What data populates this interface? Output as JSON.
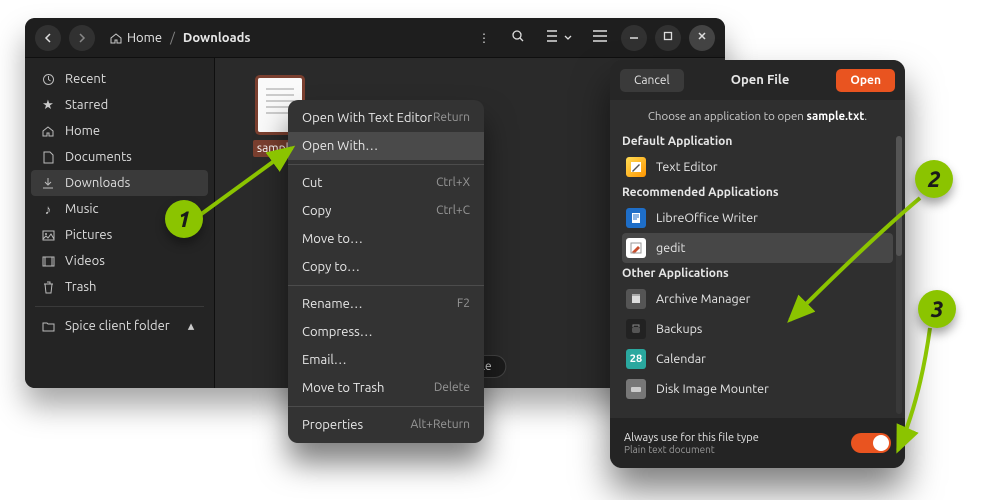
{
  "breadcrumb": {
    "home": "Home",
    "downloads": "Downloads"
  },
  "sidebar": {
    "items": [
      {
        "label": "Recent"
      },
      {
        "label": "Starred"
      },
      {
        "label": "Home"
      },
      {
        "label": "Documents"
      },
      {
        "label": "Downloads"
      },
      {
        "label": "Music"
      },
      {
        "label": "Pictures"
      },
      {
        "label": "Videos"
      },
      {
        "label": "Trash"
      }
    ],
    "spice": "Spice client folder"
  },
  "file": {
    "name": "sample.txt",
    "nameShort": "sample.t"
  },
  "statusbar": "\"sample",
  "ctx": [
    {
      "label": "Open With Text Editor",
      "accel": "Return"
    },
    {
      "label": "Open With…",
      "hl": true
    },
    null,
    {
      "label": "Cut",
      "accel": "Ctrl+X"
    },
    {
      "label": "Copy",
      "accel": "Ctrl+C"
    },
    {
      "label": "Move to…"
    },
    {
      "label": "Copy to…"
    },
    null,
    {
      "label": "Rename…",
      "accel": "F2"
    },
    {
      "label": "Compress…"
    },
    {
      "label": "Email…"
    },
    {
      "label": "Move to Trash",
      "accel": "Delete"
    },
    null,
    {
      "label": "Properties",
      "accel": "Alt+Return"
    }
  ],
  "dialog": {
    "cancel": "Cancel",
    "title": "Open File",
    "open": "Open",
    "sub_pre": "Choose an application to open ",
    "sub_file": "sample.txt",
    "sections": {
      "default": "Default Application",
      "recommended": "Recommended Applications",
      "other": "Other Applications"
    },
    "apps": {
      "text_editor": "Text Editor",
      "lowriter": "LibreOffice Writer",
      "gedit": "gedit",
      "archive": "Archive Manager",
      "backups": "Backups",
      "calendar": "Calendar",
      "disk_image": "Disk Image Mounter"
    },
    "footer_main": "Always use for this file type",
    "footer_sub": "Plain text document"
  },
  "badges": {
    "b1": "1",
    "b2": "2",
    "b3": "3"
  }
}
